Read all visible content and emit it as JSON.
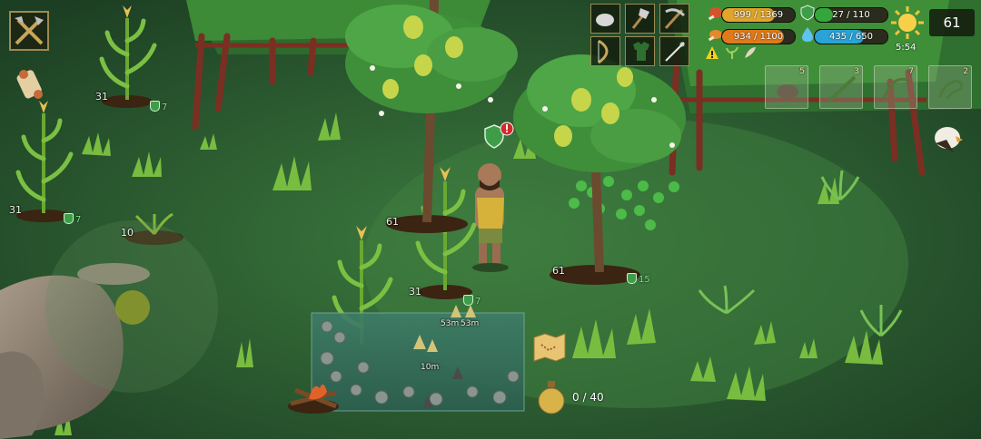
{
  "hud": {
    "day_counter": "61",
    "time": "5:54",
    "stats": {
      "food": "999 / 1369",
      "armor": "27 / 110",
      "energy": "934 / 1100",
      "water": "435 / 650"
    },
    "stat_fill": {
      "food": 0.73,
      "armor": 0.25,
      "energy": 0.85,
      "water": 0.67
    },
    "quick_slots": [
      {
        "icon": "stone-icon",
        "count": "5"
      },
      {
        "icon": "stick-icon",
        "count": "3"
      },
      {
        "icon": "rope-icon",
        "count": "7"
      },
      {
        "icon": "vine-icon",
        "count": "2"
      }
    ],
    "flask_capacity": "0 / 40"
  },
  "world_labels": {
    "plant_a_age": "31",
    "plant_a_growth": "7",
    "plant_b_age": "31",
    "plant_b_growth": "7",
    "plant_c_age": "10",
    "tree_a_age": "61",
    "tree_b_age": "61",
    "tree_b_growth": "15",
    "plant_d_age": "31",
    "plant_d_growth": "7",
    "pond_timer_1": "53m",
    "pond_timer_2": "53m",
    "pond_timer_3": "10m"
  },
  "colors": {
    "food": "#e0a52a",
    "armor": "#35a63c",
    "energy": "#e07a1a",
    "water": "#2aa3d8",
    "panel": "#14200e"
  }
}
